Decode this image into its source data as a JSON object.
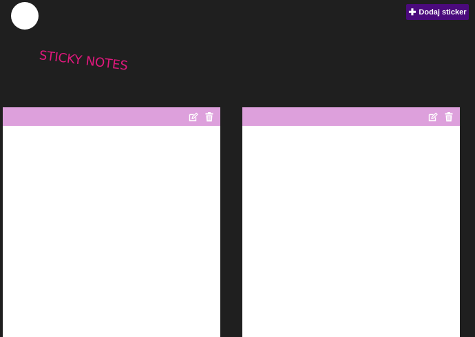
{
  "header": {
    "add_button_label": "Dodaj sticker",
    "add_button_icon": "plus-icon"
  },
  "title": "STICKY NOTES",
  "colors": {
    "background": "#1f1f1f",
    "title": "#e0187d",
    "button": "#4b0a7d",
    "note_header": "#dda0dc",
    "note_body": "#ffffff"
  },
  "notes": [
    {
      "edit_icon": "edit-icon",
      "delete_icon": "trash-icon",
      "text": ""
    },
    {
      "edit_icon": "edit-icon",
      "delete_icon": "trash-icon",
      "text": ""
    }
  ]
}
